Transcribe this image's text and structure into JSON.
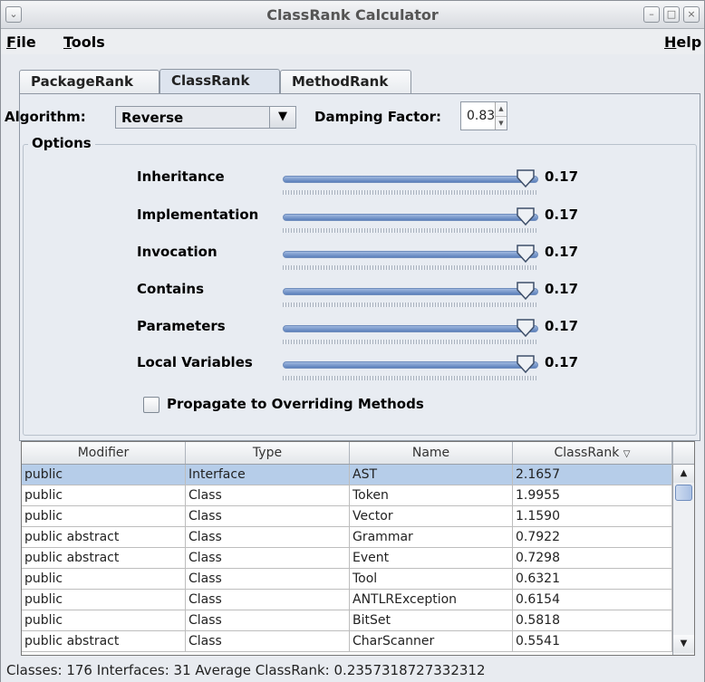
{
  "window": {
    "title": "ClassRank Calculator"
  },
  "menubar": {
    "file": {
      "mnemonic": "F",
      "rest": "ile"
    },
    "tools": {
      "mnemonic": "T",
      "rest": "ools"
    },
    "help": {
      "mnemonic": "H",
      "rest": "elp"
    }
  },
  "tabs": [
    {
      "label": "PackageRank",
      "active": false
    },
    {
      "label": "ClassRank",
      "active": true
    },
    {
      "label": "MethodRank",
      "active": false
    }
  ],
  "controls": {
    "algorithm_label": "Algorithm:",
    "algorithm_value": "Reverse",
    "damping_label": "Damping Factor:",
    "damping_value": "0.83"
  },
  "options": {
    "legend": "Options",
    "sliders": [
      {
        "label": "Inheritance",
        "value": "0.17",
        "level": 0.95
      },
      {
        "label": "Implementation",
        "value": "0.17",
        "level": 0.95
      },
      {
        "label": "Invocation",
        "value": "0.17",
        "level": 0.95
      },
      {
        "label": "Contains",
        "value": "0.17",
        "level": 0.95
      },
      {
        "label": "Parameters",
        "value": "0.17",
        "level": 0.95
      },
      {
        "label": "Local Variables",
        "value": "0.17",
        "level": 0.95
      }
    ],
    "checkbox_label": "Propagate to Overriding Methods",
    "checkbox_checked": false
  },
  "table": {
    "columns": [
      "Modifier",
      "Type",
      "Name",
      "ClassRank"
    ],
    "sort_indicator": "▽",
    "rows": [
      {
        "modifier": "public",
        "type": "Interface",
        "name": "AST",
        "rank": "2.1657",
        "selected": true
      },
      {
        "modifier": "public",
        "type": "Class",
        "name": "Token",
        "rank": "1.9955"
      },
      {
        "modifier": "public",
        "type": "Class",
        "name": "Vector",
        "rank": "1.1590"
      },
      {
        "modifier": "public abstract",
        "type": "Class",
        "name": "Grammar",
        "rank": "0.7922"
      },
      {
        "modifier": "public abstract",
        "type": "Class",
        "name": "Event",
        "rank": "0.7298"
      },
      {
        "modifier": "public",
        "type": "Class",
        "name": "Tool",
        "rank": "0.6321"
      },
      {
        "modifier": "public",
        "type": "Class",
        "name": "ANTLRException",
        "rank": "0.6154"
      },
      {
        "modifier": "public",
        "type": "Class",
        "name": "BitSet",
        "rank": "0.5818"
      },
      {
        "modifier": "public abstract",
        "type": "Class",
        "name": "CharScanner",
        "rank": "0.5541"
      }
    ]
  },
  "status": {
    "text": "Classes: 176  Interfaces: 31  Average ClassRank: 0.23573187273323​12"
  },
  "colors": {
    "selection": "#b6cde9",
    "slider_fill": "#5b80bb"
  }
}
